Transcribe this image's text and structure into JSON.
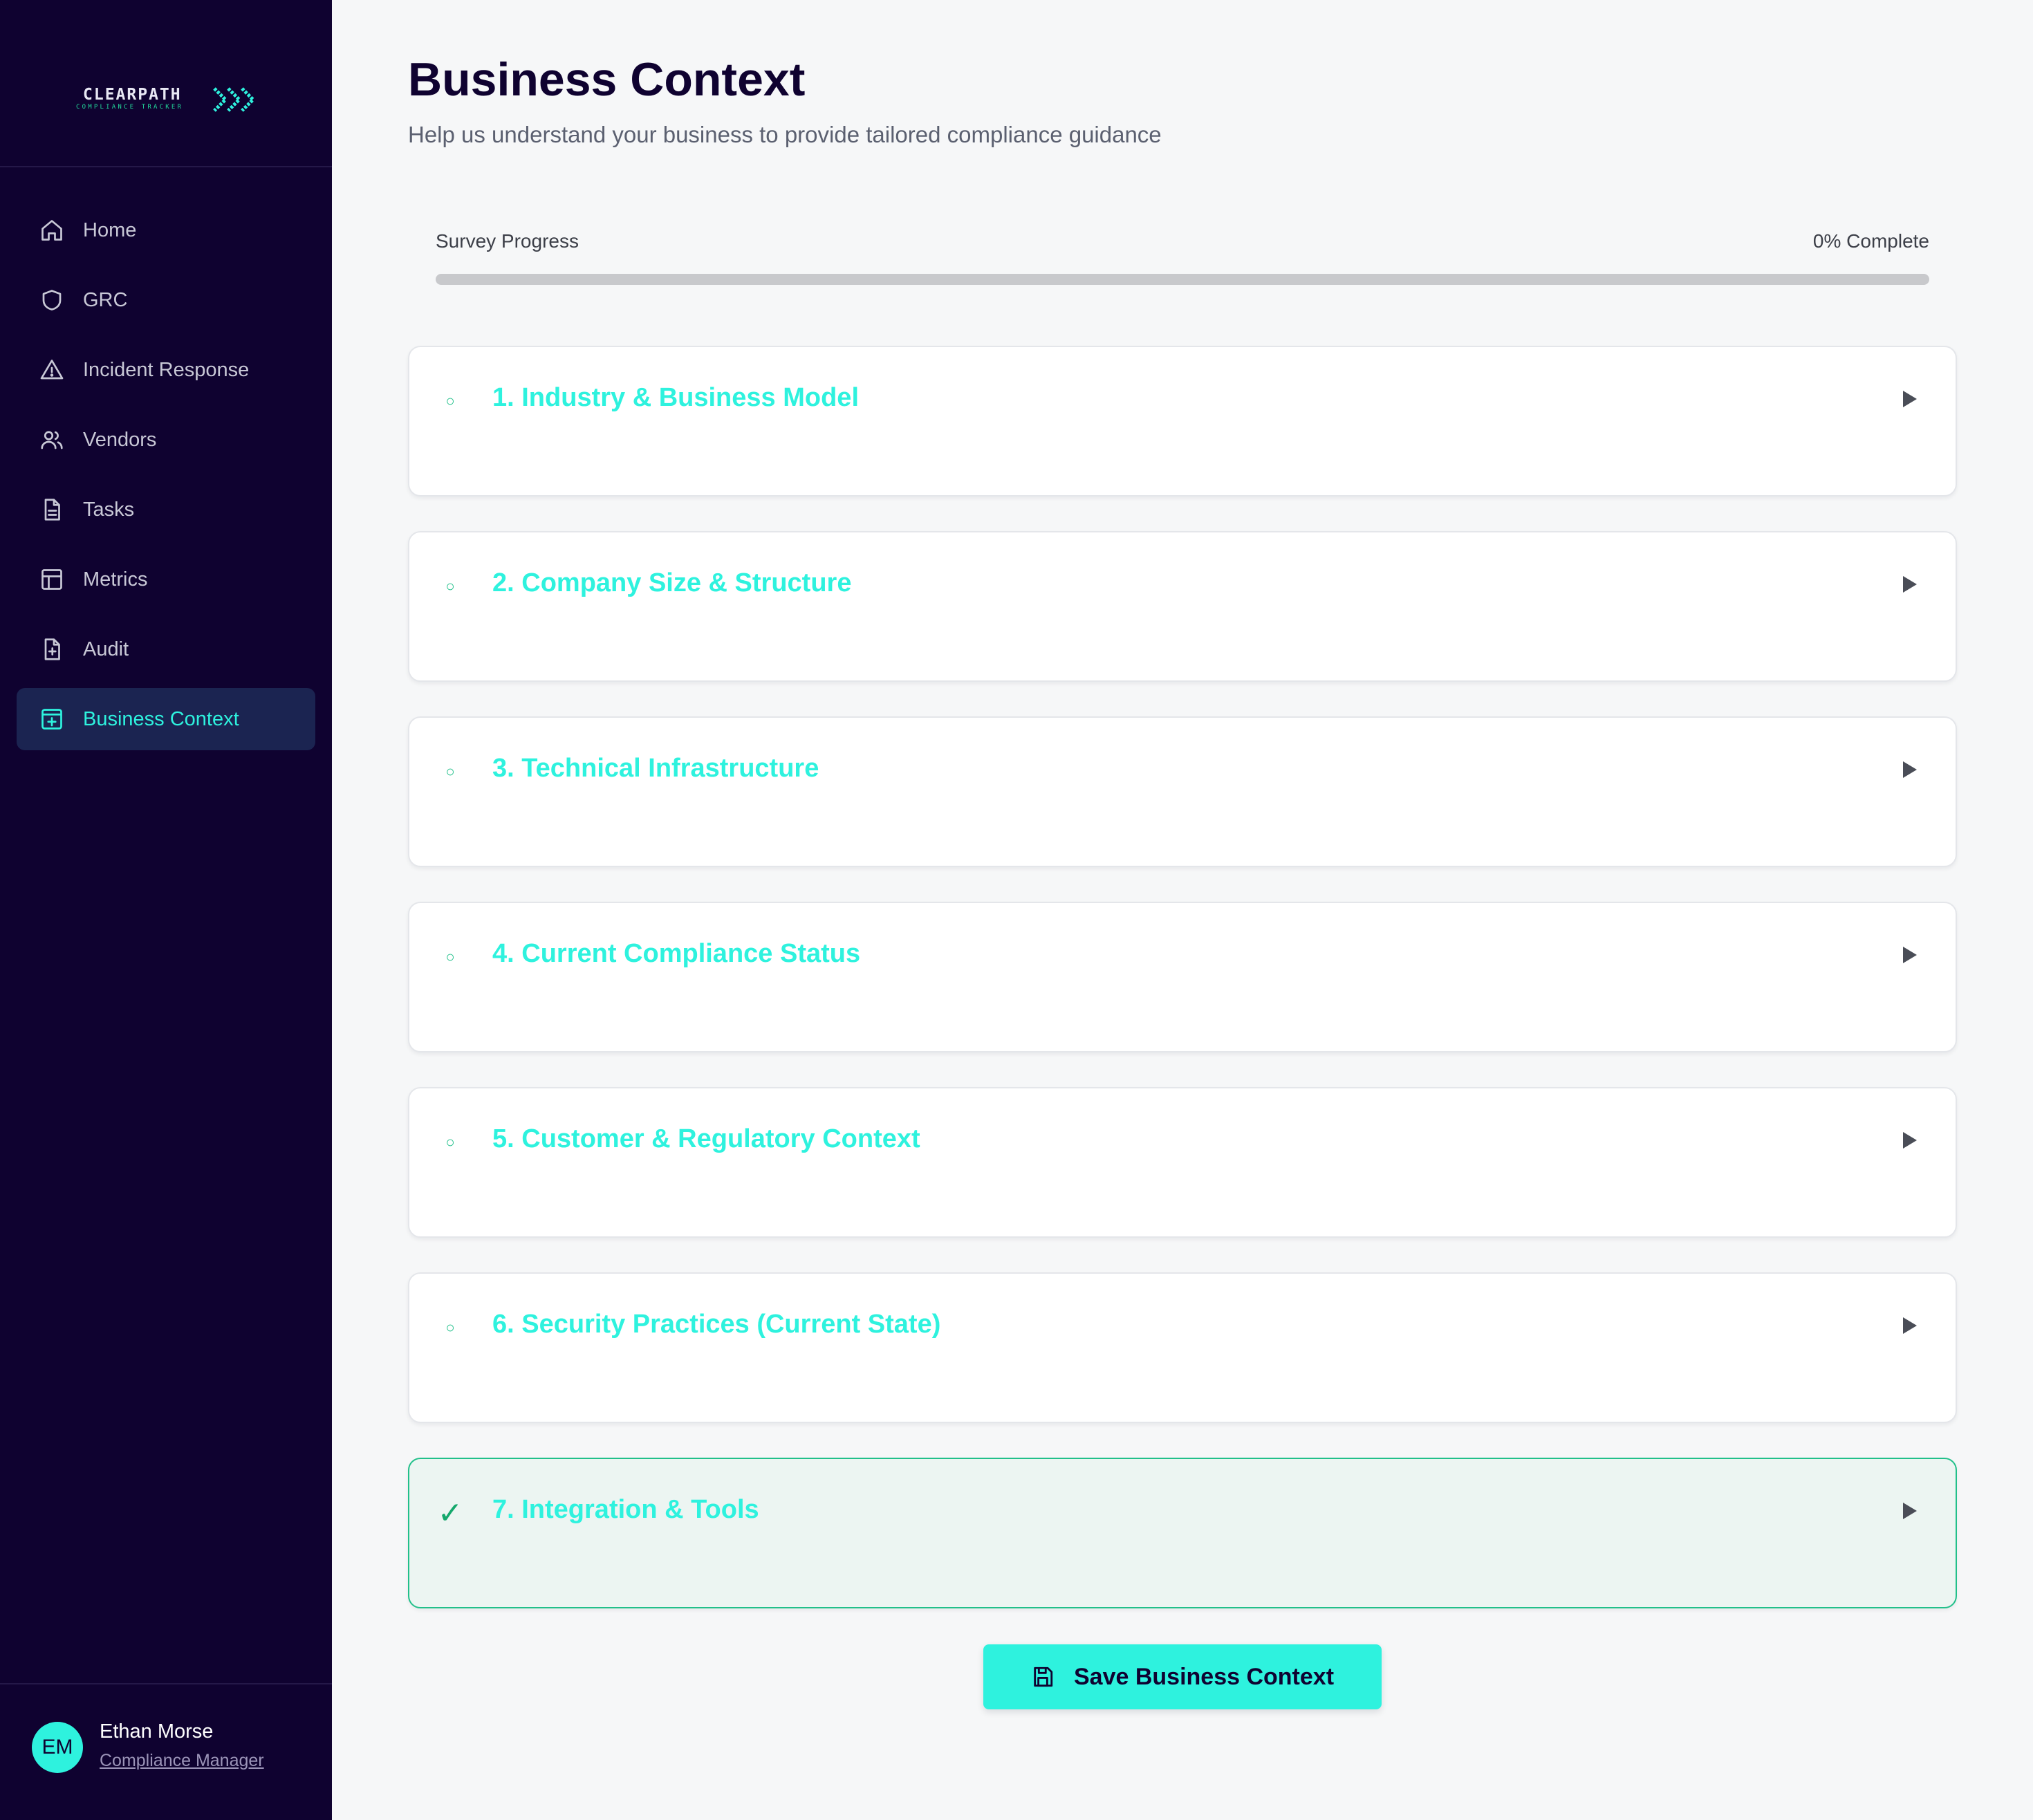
{
  "app": {
    "logo_text": "CLEARPATH",
    "logo_subtext": "COMPLIANCE TRACKER"
  },
  "sidebar": {
    "items": [
      {
        "label": "Home",
        "icon": "home-icon",
        "active": false
      },
      {
        "label": "GRC",
        "icon": "shield-icon",
        "active": false
      },
      {
        "label": "Incident Response",
        "icon": "warning-triangle-icon",
        "active": false
      },
      {
        "label": "Vendors",
        "icon": "users-icon",
        "active": false
      },
      {
        "label": "Tasks",
        "icon": "document-icon",
        "active": false
      },
      {
        "label": "Metrics",
        "icon": "layout-icon",
        "active": false
      },
      {
        "label": "Audit",
        "icon": "file-plus-icon",
        "active": false
      },
      {
        "label": "Business Context",
        "icon": "square-plus-icon",
        "active": true
      }
    ]
  },
  "user": {
    "initials": "EM",
    "name": "Ethan Morse",
    "role": "Compliance Manager"
  },
  "main": {
    "title": "Business Context",
    "subtitle": "Help us understand your business to provide tailored compliance guidance",
    "progress": {
      "label": "Survey Progress",
      "value_text": "0% Complete",
      "percent": 0
    },
    "sections": [
      {
        "title": "1. Industry & Business Model",
        "status": "incomplete",
        "status_glyph": "○"
      },
      {
        "title": "2. Company Size & Structure",
        "status": "incomplete",
        "status_glyph": "○"
      },
      {
        "title": "3. Technical Infrastructure",
        "status": "incomplete",
        "status_glyph": "○"
      },
      {
        "title": "4. Current Compliance Status",
        "status": "incomplete",
        "status_glyph": "○"
      },
      {
        "title": "5. Customer & Regulatory Context",
        "status": "incomplete",
        "status_glyph": "○"
      },
      {
        "title": "6. Security Practices (Current State)",
        "status": "incomplete",
        "status_glyph": "○"
      },
      {
        "title": "7. Integration & Tools",
        "status": "complete",
        "status_glyph": "✓"
      }
    ],
    "save_label": "Save Business Context"
  },
  "colors": {
    "sidebar_bg": "#0f0230",
    "accent": "#2ef2de",
    "success": "#21c08a",
    "page_bg": "#f6f7f8"
  }
}
